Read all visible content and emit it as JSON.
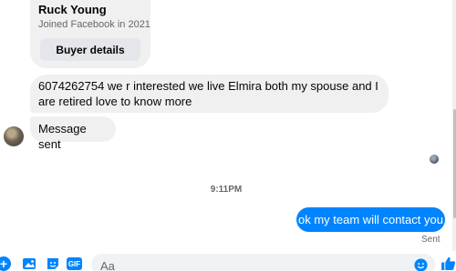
{
  "buyer": {
    "name": "Ruck Young",
    "joined": "Joined Facebook in 2021",
    "details_button": "Buyer details"
  },
  "messages": [
    {
      "text": "6074262754 we r interested we live Elmira both my spouse and I are retired love to know more",
      "direction": "incoming"
    },
    {
      "text": "Message sent",
      "direction": "incoming"
    },
    {
      "text": "ok my team will contact you",
      "direction": "outgoing"
    }
  ],
  "timestamp": "9:11PM",
  "status": "Sent",
  "composer": {
    "placeholder": "Aa",
    "icons": [
      "plus-icon",
      "photo-icon",
      "sticker-icon",
      "gif-icon",
      "emoji-icon",
      "like-icon"
    ],
    "gif_label": "GIF"
  },
  "colors": {
    "accent": "#0084ff",
    "bubble_in": "#f0f0f0",
    "secondary_text": "#65676b"
  }
}
